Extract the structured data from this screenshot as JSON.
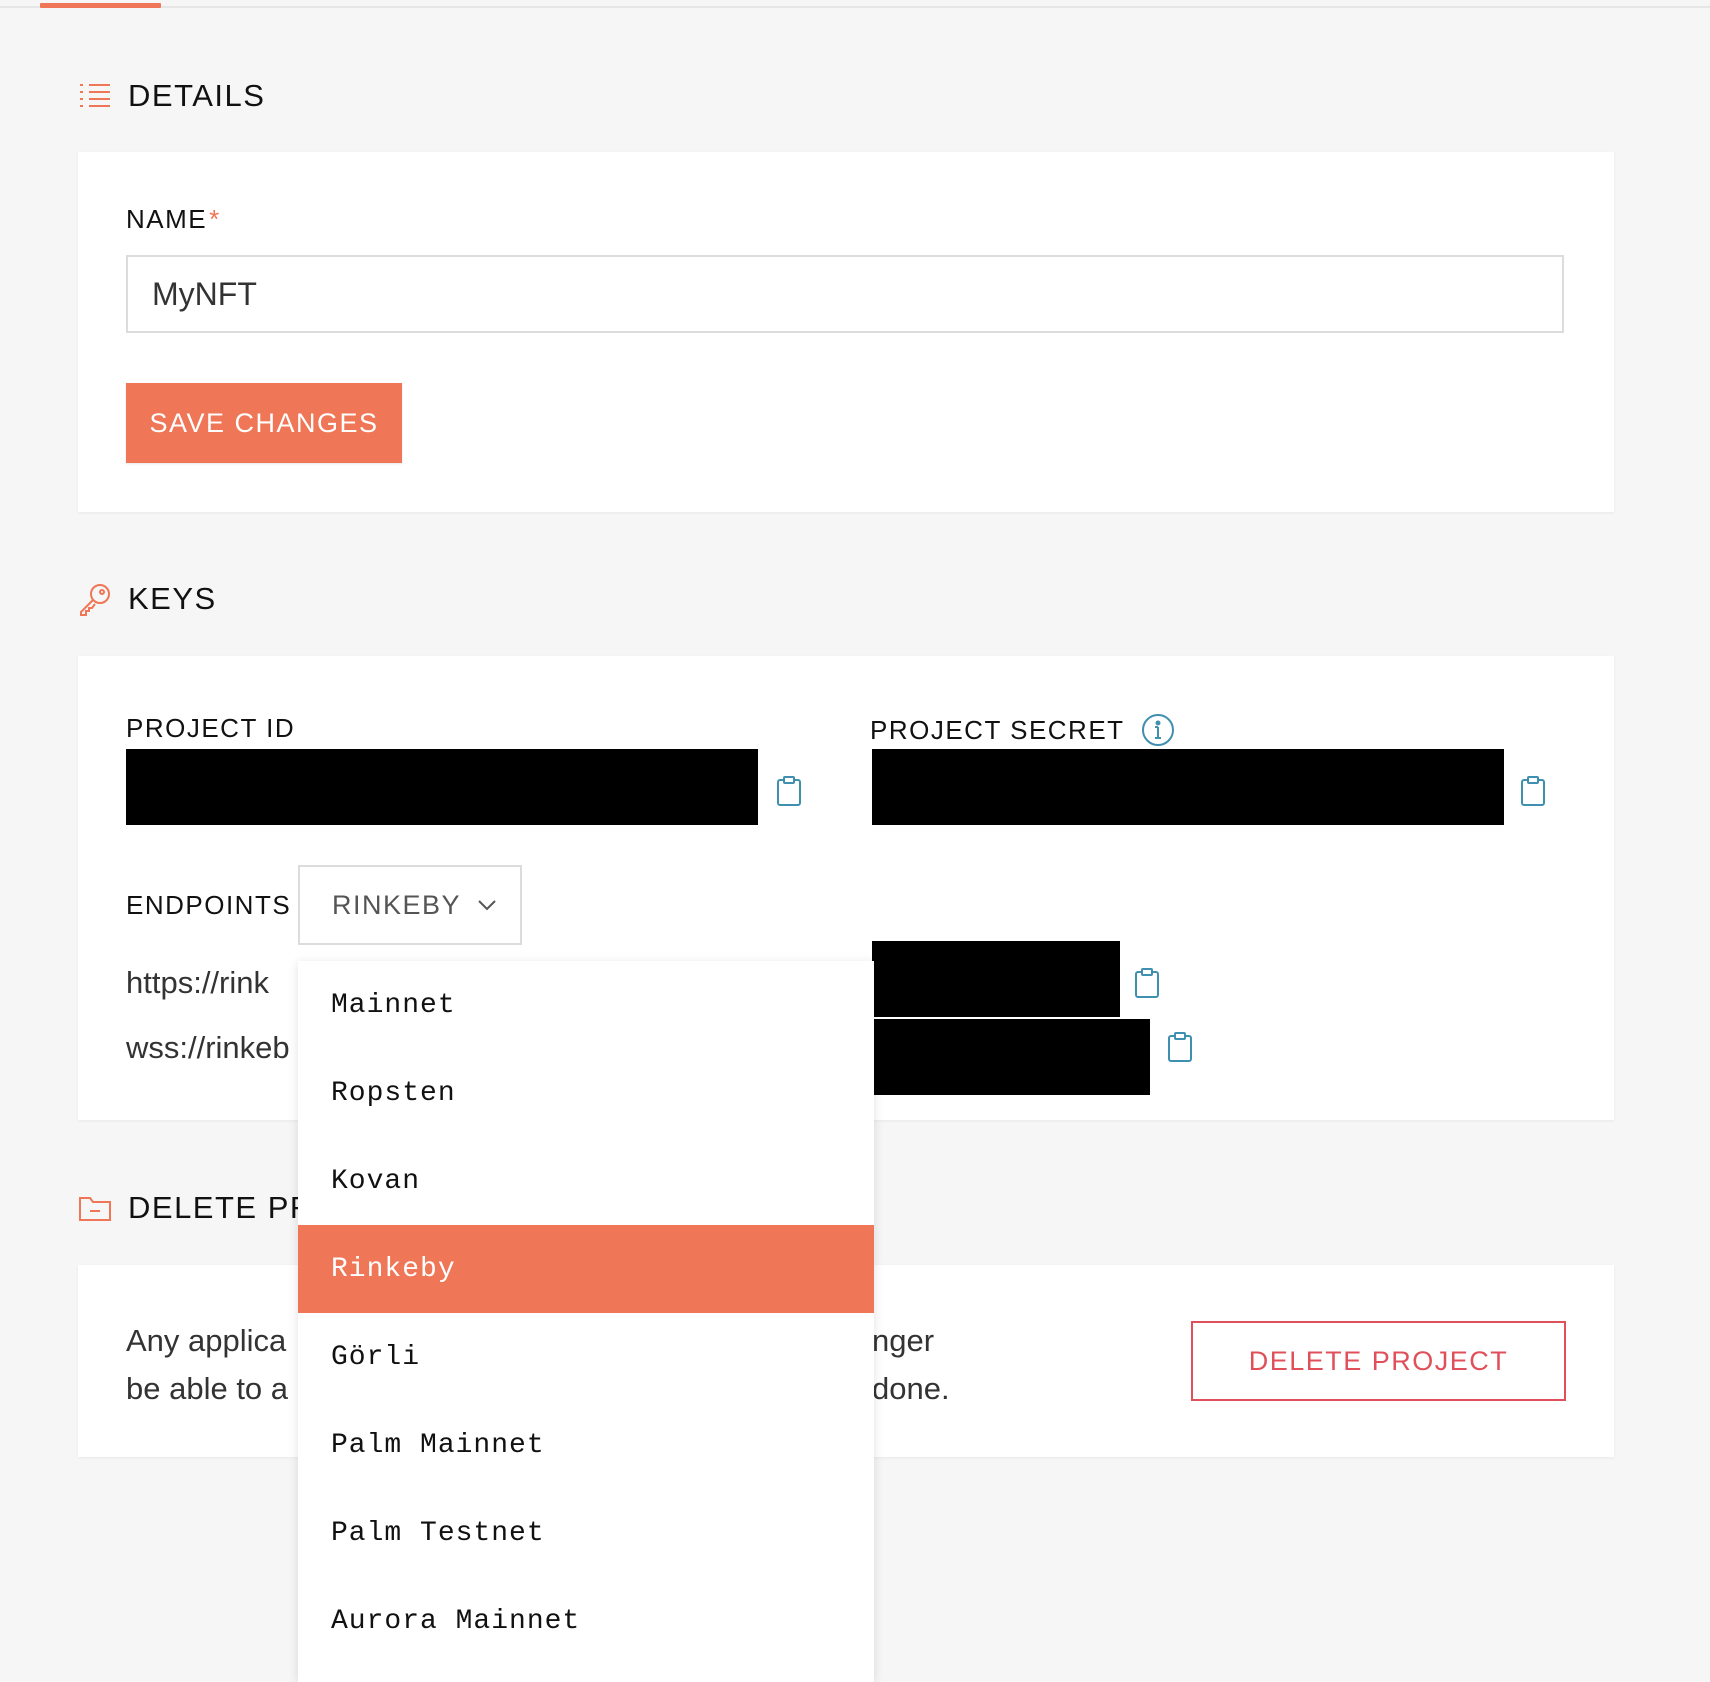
{
  "sections": {
    "details": {
      "title": "DETAILS"
    },
    "keys": {
      "title": "KEYS"
    },
    "delete": {
      "title": "DELETE PR"
    }
  },
  "details": {
    "name_label": "NAME",
    "required_mark": "*",
    "name_value": "MyNFT",
    "save_label": "SAVE CHANGES"
  },
  "keys": {
    "project_id_label": "PROJECT ID",
    "project_secret_label": "PROJECT SECRET",
    "endpoints_label": "ENDPOINTS",
    "endpoint_selected": "RINKEBY",
    "https_url_visible": "https://rink",
    "wss_url_visible": "wss://rinkeb"
  },
  "delete": {
    "text_line1": "Any applica",
    "text_line1_end": "nger",
    "text_line2": "be able to a",
    "text_line2_end": "done.",
    "button_label": "DELETE PROJECT"
  },
  "dropdown": {
    "items": [
      "Mainnet",
      "Ropsten",
      "Kovan",
      "Rinkeby",
      "Görli",
      "Palm Mainnet",
      "Palm Testnet",
      "Aurora Mainnet"
    ],
    "selected": "Rinkeby"
  },
  "colors": {
    "accent": "#ef7656",
    "danger": "#e0505a",
    "info": "#3f8fb0",
    "page_bg": "#f6f6f6"
  },
  "icons": {
    "details": "list-icon",
    "keys": "key-icon",
    "delete": "folder-icon",
    "copy": "clipboard-icon",
    "info": "info-icon",
    "dropdown": "chevron-down-icon"
  }
}
